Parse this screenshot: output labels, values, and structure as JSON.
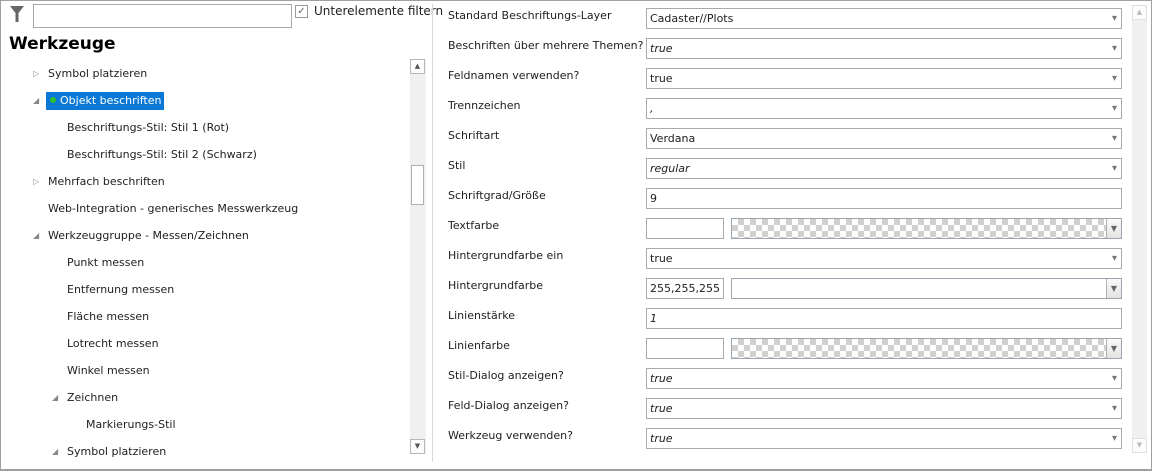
{
  "left": {
    "search_value": "",
    "filter_children_label": "Unterelemente filtern",
    "filter_children_checked": true,
    "title": "Werkzeuge",
    "tree": [
      {
        "label": "Symbol platzieren",
        "level": 0,
        "expander": "collapsed"
      },
      {
        "label": "Objekt beschriften",
        "level": 0,
        "expander": "expanded",
        "selected": true,
        "active": true
      },
      {
        "label": "Beschriftungs-Stil: Stil 1 (Rot)",
        "level": 1,
        "expander": "none"
      },
      {
        "label": "Beschriftungs-Stil: Stil 2 (Schwarz)",
        "level": 1,
        "expander": "none"
      },
      {
        "label": "Mehrfach beschriften",
        "level": 0,
        "expander": "collapsed"
      },
      {
        "label": "Web-Integration - generisches Messwerkzeug",
        "level": 0,
        "expander": "none"
      },
      {
        "label": "Werkzeuggruppe - Messen/Zeichnen",
        "level": 0,
        "expander": "expanded"
      },
      {
        "label": "Punkt messen",
        "level": 1,
        "expander": "none"
      },
      {
        "label": "Entfernung messen",
        "level": 1,
        "expander": "none"
      },
      {
        "label": "Fläche messen",
        "level": 1,
        "expander": "none"
      },
      {
        "label": "Lotrecht messen",
        "level": 1,
        "expander": "none"
      },
      {
        "label": "Winkel messen",
        "level": 1,
        "expander": "none"
      },
      {
        "label": "Zeichnen",
        "level": 1,
        "expander": "expanded"
      },
      {
        "label": "Markierungs-Stil",
        "level": 2,
        "expander": "none"
      },
      {
        "label": "Symbol platzieren",
        "level": 1,
        "expander": "expanded"
      }
    ]
  },
  "properties": [
    {
      "label": "Standard Beschriftungs-Layer",
      "value": "Cadaster//Plots",
      "type": "dropdown",
      "italic": false
    },
    {
      "label": "Beschriften über mehrere Themen?",
      "value": "true",
      "type": "dropdown",
      "italic": true
    },
    {
      "label": "Feldnamen verwenden?",
      "value": "true",
      "type": "dropdown",
      "italic": false
    },
    {
      "label": "Trennzeichen",
      "value": ",",
      "type": "dropdown",
      "italic": true
    },
    {
      "label": "Schriftart",
      "value": "Verdana",
      "type": "dropdown",
      "italic": false
    },
    {
      "label": "Stil",
      "value": "regular",
      "type": "dropdown",
      "italic": true
    },
    {
      "label": "Schriftgrad/Größe",
      "value": "9",
      "type": "text",
      "italic": false
    },
    {
      "label": "Textfarbe",
      "value": "",
      "type": "color",
      "transparent": true
    },
    {
      "label": "Hintergrundfarbe ein",
      "value": "true",
      "type": "dropdown",
      "italic": false
    },
    {
      "label": "Hintergrundfarbe",
      "value": "255,255,255",
      "type": "color",
      "transparent": false
    },
    {
      "label": "Linienstärke",
      "value": "1",
      "type": "text",
      "italic": true
    },
    {
      "label": "Linienfarbe",
      "value": "",
      "type": "color",
      "transparent": true
    },
    {
      "label": "Stil-Dialog anzeigen?",
      "value": "true",
      "type": "dropdown",
      "italic": true
    },
    {
      "label": "Feld-Dialog anzeigen?",
      "value": "true",
      "type": "dropdown",
      "italic": true
    },
    {
      "label": "Werkzeug verwenden?",
      "value": "true",
      "type": "dropdown",
      "italic": true
    }
  ],
  "colors": {
    "selection": "#0a78d7",
    "active_dot": "#2fc230"
  }
}
